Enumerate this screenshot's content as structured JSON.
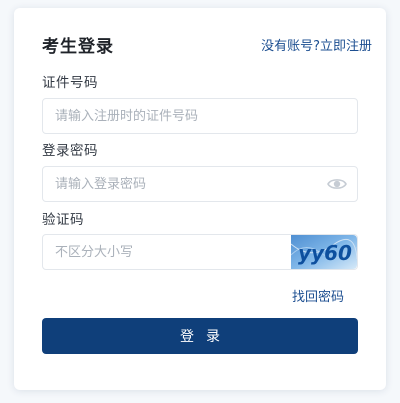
{
  "login": {
    "title": "考生登录",
    "register_link": "没有账号?立即注册",
    "id_label": "证件号码",
    "id_placeholder": "请输入注册时的证件号码",
    "password_label": "登录密码",
    "password_placeholder": "请输入登录密码",
    "captcha_label": "验证码",
    "captcha_placeholder": "不区分大小写",
    "captcha_text": "yy60",
    "forgot_link": "找回密码",
    "submit_label": "登录",
    "eye_icon": "eye-icon"
  },
  "colors": {
    "primary": "#0f3f7a",
    "link": "#1d4f91",
    "captcha_bg": "#5a9ad6",
    "captcha_text": "#0d4f9e"
  }
}
